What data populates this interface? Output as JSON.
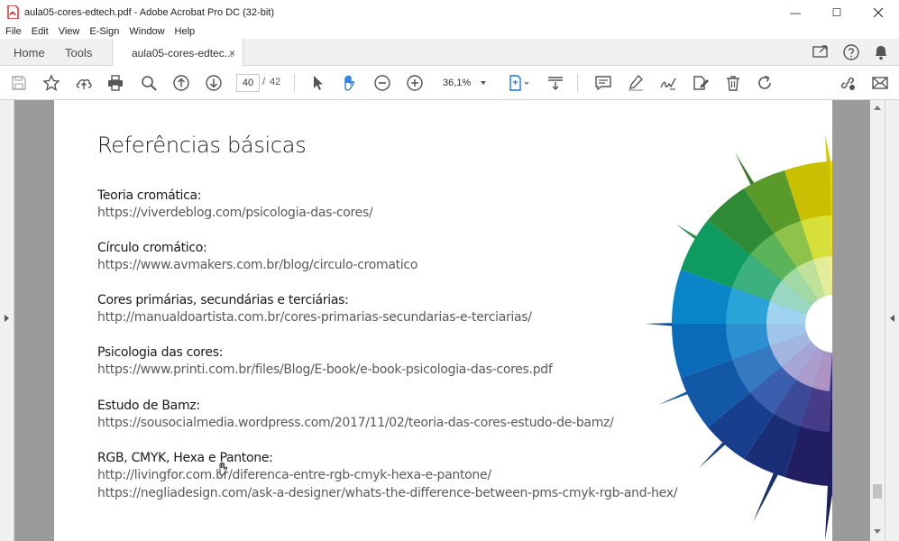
{
  "window": {
    "title": "aula05-cores-edtech.pdf - Adobe Acrobat Pro DC (32-bit)",
    "minimize": "—",
    "maximize": "☐"
  },
  "menu": [
    "File",
    "Edit",
    "View",
    "E-Sign",
    "Window",
    "Help"
  ],
  "tabs": {
    "home": "Home",
    "tools": "Tools",
    "document": "aula05-cores-edtec...",
    "close": "×"
  },
  "toolbar": {
    "page_current": "40",
    "page_separator": "/",
    "page_total": "42",
    "zoom": "36,1%"
  },
  "document": {
    "heading": "Referências básicas",
    "references": [
      {
        "label": "Teoria cromática:",
        "urls": [
          "https://viverdeblog.com/psicologia-das-cores/"
        ]
      },
      {
        "label": "Círculo cromático:",
        "urls": [
          "https://www.avmakers.com.br/blog/circulo-cromatico"
        ]
      },
      {
        "label": "Cores primárias, secundárias e terciárias:",
        "urls": [
          "http://manualdoartista.com.br/cores-primarias-secundarias-e-terciarias/"
        ]
      },
      {
        "label": "Psicologia das cores:",
        "urls": [
          "https://www.printi.com.br/files/Blog/E-book/e-book-psicologia-das-cores.pdf"
        ]
      },
      {
        "label": "Estudo de Bamz:",
        "urls": [
          "https://sousocialmedia.wordpress.com/2017/11/02/teoria-das-cores-estudo-de-bamz/"
        ]
      },
      {
        "label": "RGB, CMYK, Hexa e Pantone:",
        "urls": [
          "http://livingfor.com.br/diferenca-entre-rgb-cmyk-hexa-e-pantone/",
          "https://negliadesign.com/ask-a-designer/whats-the-difference-between-pms-cmyk-rgb-and-hex/"
        ]
      }
    ]
  },
  "icons": [
    "save-icon",
    "bookmark-star-icon",
    "upload-cloud-icon",
    "print-icon",
    "search-zoom-icon",
    "page-up-icon",
    "page-down-icon",
    "select-arrow-icon",
    "hand-icon",
    "zoom-out-icon",
    "zoom-in-icon",
    "fit-page-icon",
    "scroll-mode-icon",
    "comment-icon",
    "highlight-icon",
    "sign-icon",
    "edit-pdf-icon",
    "delete-icon",
    "rotate-icon",
    "share-link-icon",
    "email-icon"
  ],
  "colors": {
    "accent": "#1473e6",
    "doc_background": "#9b9b9b"
  }
}
